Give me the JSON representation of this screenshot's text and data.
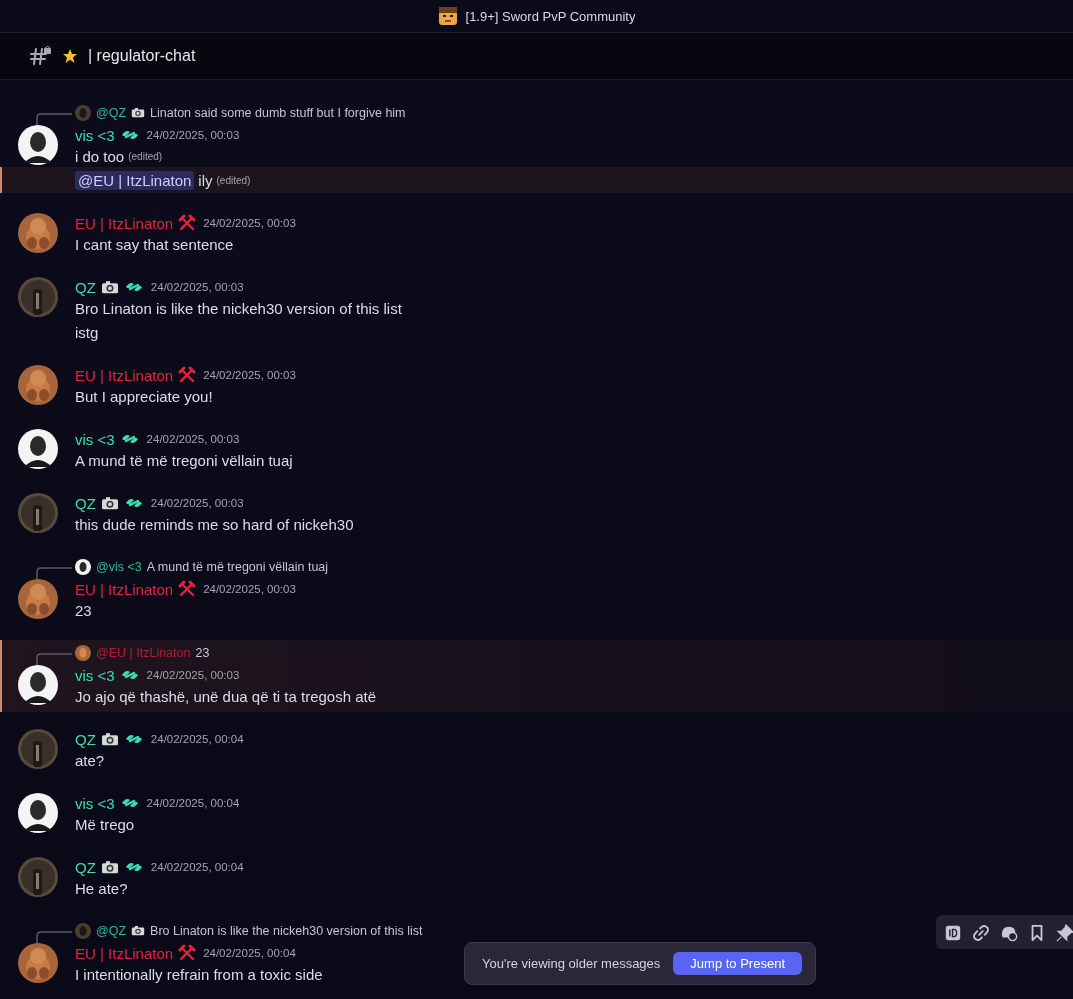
{
  "window": {
    "title": "[1.9+] Sword PvP Community"
  },
  "channel": {
    "name": "| regulator-chat"
  },
  "messages": [
    {
      "author": "vis <3",
      "color": "#3ddcb5",
      "badges": [
        {
          "kind": "wave"
        }
      ],
      "timestamp": "24/02/2025, 00:03",
      "highlighted": false,
      "reply": {
        "author": "@QZ",
        "color": "#2fb894",
        "badges": [
          {
            "kind": "camera"
          }
        ],
        "text": "Linaton said some dumb stuff but I forgive him"
      },
      "lines": [
        {
          "text": "i do too",
          "edited": "(edited)",
          "highlighted": false
        },
        {
          "mention": "@EU | ItzLinaton",
          "text": "ily",
          "edited": "(edited)",
          "highlighted": true
        }
      ]
    },
    {
      "author": "EU | ItzLinaton",
      "color": "#e8213f",
      "badges": [
        {
          "kind": "hammer"
        }
      ],
      "timestamp": "24/02/2025, 00:03",
      "highlighted": false,
      "lines": [
        {
          "text": "I cant say that sentence",
          "highlighted": false
        }
      ]
    },
    {
      "author": "QZ",
      "color": "#3ddcb5",
      "badges": [
        {
          "kind": "camera"
        },
        {
          "kind": "wave"
        }
      ],
      "timestamp": "24/02/2025, 00:03",
      "highlighted": false,
      "lines": [
        {
          "text": "Bro Linaton is like the nickeh30 version of this list",
          "highlighted": false
        },
        {
          "text": "istg",
          "highlighted": false
        }
      ]
    },
    {
      "author": "EU | ItzLinaton",
      "color": "#e8213f",
      "badges": [
        {
          "kind": "hammer"
        }
      ],
      "timestamp": "24/02/2025, 00:03",
      "highlighted": false,
      "lines": [
        {
          "text": "But I appreciate you!",
          "highlighted": false
        }
      ]
    },
    {
      "author": "vis <3",
      "color": "#3ddcb5",
      "badges": [
        {
          "kind": "wave"
        }
      ],
      "timestamp": "24/02/2025, 00:03",
      "highlighted": false,
      "lines": [
        {
          "text": "A mund të më tregoni vëllain tuaj",
          "highlighted": false
        }
      ]
    },
    {
      "author": "QZ",
      "color": "#3ddcb5",
      "badges": [
        {
          "kind": "camera"
        },
        {
          "kind": "wave"
        }
      ],
      "timestamp": "24/02/2025, 00:03",
      "highlighted": false,
      "lines": [
        {
          "text": "this dude reminds me so hard of nickeh30",
          "highlighted": false
        }
      ]
    },
    {
      "author": "EU | ItzLinaton",
      "color": "#e8213f",
      "badges": [
        {
          "kind": "hammer"
        }
      ],
      "timestamp": "24/02/2025, 00:03",
      "highlighted": false,
      "reply": {
        "author": "@vis <3",
        "color": "#2fb894",
        "text": "A mund të më tregoni vëllain tuaj"
      },
      "lines": [
        {
          "text": "23",
          "highlighted": false
        }
      ]
    },
    {
      "author": "vis <3",
      "color": "#3ddcb5",
      "badges": [
        {
          "kind": "wave"
        }
      ],
      "timestamp": "24/02/2025, 00:03",
      "highlighted": true,
      "reply": {
        "author": "@EU | ItzLinaton",
        "color": "#b81c35",
        "text": "23"
      },
      "lines": [
        {
          "text": "Jo ajo që thashë, unë dua që ti ta tregosh atë",
          "highlighted": false
        }
      ]
    },
    {
      "author": "QZ",
      "color": "#3ddcb5",
      "badges": [
        {
          "kind": "camera"
        },
        {
          "kind": "wave"
        }
      ],
      "timestamp": "24/02/2025, 00:04",
      "highlighted": false,
      "lines": [
        {
          "text": "ate?",
          "highlighted": false
        }
      ]
    },
    {
      "author": "vis <3",
      "color": "#3ddcb5",
      "badges": [
        {
          "kind": "wave"
        }
      ],
      "timestamp": "24/02/2025, 00:04",
      "highlighted": false,
      "lines": [
        {
          "text": "Më trego",
          "highlighted": false
        }
      ]
    },
    {
      "author": "QZ",
      "color": "#3ddcb5",
      "badges": [
        {
          "kind": "camera"
        },
        {
          "kind": "wave"
        }
      ],
      "timestamp": "24/02/2025, 00:04",
      "highlighted": false,
      "lines": [
        {
          "text": "He ate?",
          "highlighted": false
        }
      ]
    },
    {
      "author": "EU | ItzLinaton",
      "color": "#e8213f",
      "badges": [
        {
          "kind": "hammer"
        }
      ],
      "timestamp": "24/02/2025, 00:04",
      "highlighted": false,
      "reply": {
        "author": "@QZ",
        "color": "#2fb894",
        "badges": [
          {
            "kind": "camera"
          }
        ],
        "text": "Bro Linaton is like the nickeh30 version of this list"
      },
      "lines": [
        {
          "text": "I intentionally refrain from a toxic side",
          "highlighted": false
        }
      ]
    }
  ],
  "older_banner": {
    "text": "You're viewing older messages",
    "button": "Jump to Present"
  },
  "toolbar": {
    "items": [
      {
        "kind": "id"
      },
      {
        "kind": "link"
      },
      {
        "kind": "thread"
      },
      {
        "kind": "bookmark"
      },
      {
        "kind": "pin"
      }
    ]
  }
}
